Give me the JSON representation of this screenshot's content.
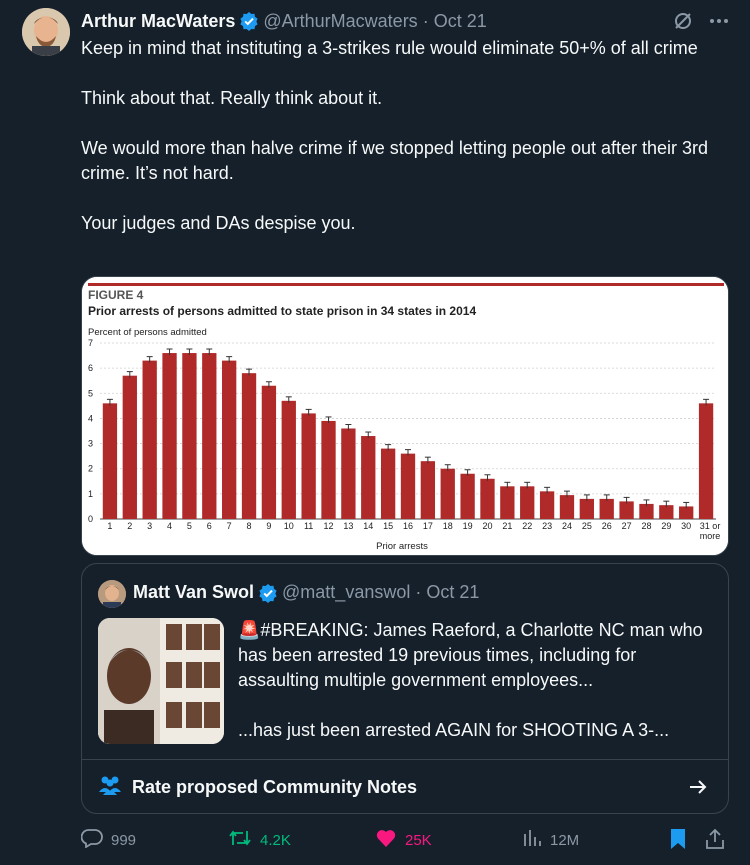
{
  "author": {
    "name": "Arthur MacWaters",
    "handle": "@ArthurMacwaters",
    "separator": "·",
    "date": "Oct 21"
  },
  "header_icons": [
    "grok-icon",
    "more-icon"
  ],
  "body": {
    "p1": "Keep in mind that instituting a 3-strikes rule would eliminate 50+% of all crime",
    "p2": "Think about that. Really think about it.",
    "p3": "We would more than halve crime if we stopped letting people out after their 3rd  crime. It’s not hard.",
    "p4": "Your judges and DAs despise you."
  },
  "chart_data": {
    "type": "bar",
    "figure_label": "FIGURE 4",
    "title": "Prior arrests of persons admitted to state prison in 34 states in 2014",
    "ylabel": "Percent of persons admitted",
    "xlabel": "Prior arrests",
    "ylim": [
      0,
      7
    ],
    "yticks": [
      "0",
      "1",
      "2",
      "3",
      "4",
      "5",
      "6",
      "7"
    ],
    "categories": [
      "1",
      "2",
      "3",
      "4",
      "5",
      "6",
      "7",
      "8",
      "9",
      "10",
      "11",
      "12",
      "13",
      "14",
      "15",
      "16",
      "17",
      "18",
      "19",
      "20",
      "21",
      "22",
      "23",
      "24",
      "25",
      "26",
      "27",
      "28",
      "29",
      "30",
      "31 or more"
    ],
    "values": [
      4.6,
      5.7,
      6.3,
      6.6,
      6.6,
      6.6,
      6.3,
      5.8,
      5.3,
      4.7,
      4.2,
      3.9,
      3.6,
      3.3,
      2.8,
      2.6,
      2.3,
      2.0,
      1.8,
      1.6,
      1.3,
      1.3,
      1.1,
      0.95,
      0.8,
      0.8,
      0.7,
      0.6,
      0.55,
      0.5,
      4.6
    ],
    "bar_color": "#b02a2a",
    "grid": true
  },
  "quote": {
    "name": "Matt Van Swol",
    "handle": "@matt_vanswol",
    "separator": "·",
    "date": "Oct 21",
    "emoji": "🚨",
    "p1": "#BREAKING: James Raeford, a Charlotte NC man who has been arrested 19 previous times, including for assaulting multiple government employees...",
    "p2": "...has just been arrested AGAIN for SHOOTING A 3-..."
  },
  "community_notes": {
    "label": "Rate proposed Community Notes"
  },
  "actions": {
    "replies": "999",
    "reposts": "4.2K",
    "likes": "25K",
    "views": "12M"
  },
  "colors": {
    "background": "#15202b",
    "text": "#f7f9f9",
    "muted": "#8b98a5",
    "repost_green": "#00ba7c",
    "like_pink": "#f91880",
    "verified_blue": "#1d9bf0",
    "bookmark_blue": "#1d9bf0"
  }
}
